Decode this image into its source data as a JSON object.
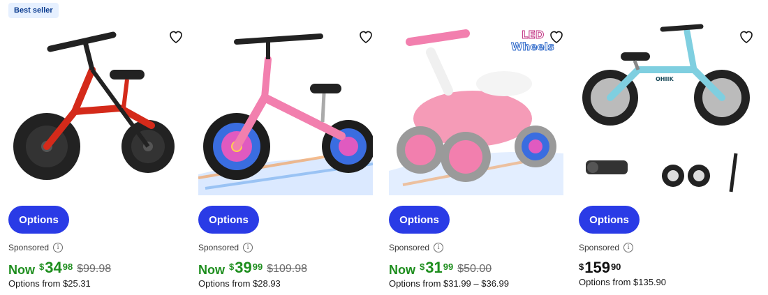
{
  "products": [
    {
      "badge": "Best seller",
      "button": "Options",
      "sponsored": "Sponsored",
      "info_glyph": "i",
      "now_label": "Now",
      "currency": "$",
      "price_dollars": "34",
      "price_cents": "98",
      "was_price": "$99.98",
      "options_from": "Options from $25.31",
      "image_icon": "red-balance-bike",
      "color": "#d42a1a"
    },
    {
      "button": "Options",
      "sponsored": "Sponsored",
      "info_glyph": "i",
      "now_label": "Now",
      "currency": "$",
      "price_dollars": "39",
      "price_cents": "99",
      "was_price": "$109.98",
      "options_from": "Options from $28.93",
      "image_icon": "pink-balance-bike-light-wheels",
      "color": "#f27fae"
    },
    {
      "button": "Options",
      "sponsored": "Sponsored",
      "info_glyph": "i",
      "now_label": "Now",
      "currency": "$",
      "price_dollars": "31",
      "price_cents": "99",
      "was_price": "$50.00",
      "options_from": "Options from $31.99 – $36.99",
      "image_icon": "pink-toddler-balance-bike",
      "image_text_line1": "LED",
      "image_text_line2": "Wheels",
      "color": "#f59bb7"
    },
    {
      "button": "Options",
      "sponsored": "Sponsored",
      "info_glyph": "i",
      "currency": "$",
      "price_dollars": "159",
      "price_cents": "90",
      "options_from": "Options from $135.90",
      "image_icon": "blue-balance-bike-with-accessories",
      "image_text_brand": "OHIIK",
      "color": "#7fcfe0"
    }
  ],
  "colors": {
    "button_bg": "#2a3be6",
    "now_green": "#1e8e1e",
    "badge_bg": "#e6f0ff",
    "badge_text": "#0b3b8f"
  }
}
